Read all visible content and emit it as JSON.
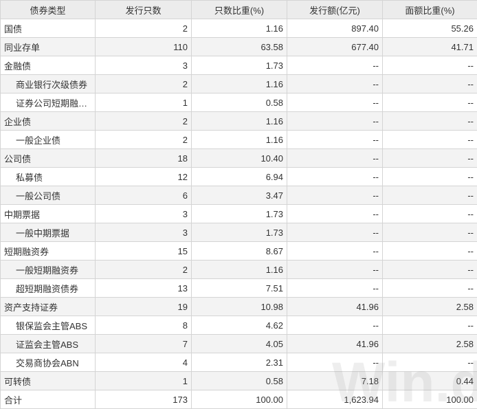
{
  "headers": [
    "债券类型",
    "发行只数",
    "只数比重(%)",
    "发行额(亿元)",
    "面额比重(%)"
  ],
  "rows": [
    {
      "name": "国债",
      "indent": false,
      "count": "2",
      "count_pct": "1.16",
      "amount": "897.40",
      "amount_pct": "55.26"
    },
    {
      "name": "同业存单",
      "indent": false,
      "count": "110",
      "count_pct": "63.58",
      "amount": "677.40",
      "amount_pct": "41.71"
    },
    {
      "name": "金融债",
      "indent": false,
      "count": "3",
      "count_pct": "1.73",
      "amount": "--",
      "amount_pct": "--"
    },
    {
      "name": "商业银行次级债券",
      "indent": true,
      "count": "2",
      "count_pct": "1.16",
      "amount": "--",
      "amount_pct": "--"
    },
    {
      "name": "证券公司短期融…",
      "indent": true,
      "count": "1",
      "count_pct": "0.58",
      "amount": "--",
      "amount_pct": "--"
    },
    {
      "name": "企业债",
      "indent": false,
      "count": "2",
      "count_pct": "1.16",
      "amount": "--",
      "amount_pct": "--"
    },
    {
      "name": "一般企业债",
      "indent": true,
      "count": "2",
      "count_pct": "1.16",
      "amount": "--",
      "amount_pct": "--"
    },
    {
      "name": "公司债",
      "indent": false,
      "count": "18",
      "count_pct": "10.40",
      "amount": "--",
      "amount_pct": "--"
    },
    {
      "name": "私募债",
      "indent": true,
      "count": "12",
      "count_pct": "6.94",
      "amount": "--",
      "amount_pct": "--"
    },
    {
      "name": "一般公司债",
      "indent": true,
      "count": "6",
      "count_pct": "3.47",
      "amount": "--",
      "amount_pct": "--"
    },
    {
      "name": "中期票据",
      "indent": false,
      "count": "3",
      "count_pct": "1.73",
      "amount": "--",
      "amount_pct": "--"
    },
    {
      "name": "一般中期票据",
      "indent": true,
      "count": "3",
      "count_pct": "1.73",
      "amount": "--",
      "amount_pct": "--"
    },
    {
      "name": "短期融资券",
      "indent": false,
      "count": "15",
      "count_pct": "8.67",
      "amount": "--",
      "amount_pct": "--"
    },
    {
      "name": "一般短期融资券",
      "indent": true,
      "count": "2",
      "count_pct": "1.16",
      "amount": "--",
      "amount_pct": "--"
    },
    {
      "name": "超短期融资债券",
      "indent": true,
      "count": "13",
      "count_pct": "7.51",
      "amount": "--",
      "amount_pct": "--"
    },
    {
      "name": "资产支持证券",
      "indent": false,
      "count": "19",
      "count_pct": "10.98",
      "amount": "41.96",
      "amount_pct": "2.58"
    },
    {
      "name": "银保监会主管ABS",
      "indent": true,
      "count": "8",
      "count_pct": "4.62",
      "amount": "--",
      "amount_pct": "--"
    },
    {
      "name": "证监会主管ABS",
      "indent": true,
      "count": "7",
      "count_pct": "4.05",
      "amount": "41.96",
      "amount_pct": "2.58"
    },
    {
      "name": "交易商协会ABN",
      "indent": true,
      "count": "4",
      "count_pct": "2.31",
      "amount": "--",
      "amount_pct": "--"
    },
    {
      "name": "可转债",
      "indent": false,
      "count": "1",
      "count_pct": "0.58",
      "amount": "7.18",
      "amount_pct": "0.44"
    },
    {
      "name": "合计",
      "indent": false,
      "count": "173",
      "count_pct": "100.00",
      "amount": "1,623.94",
      "amount_pct": "100.00"
    }
  ],
  "watermark": "Win.d"
}
